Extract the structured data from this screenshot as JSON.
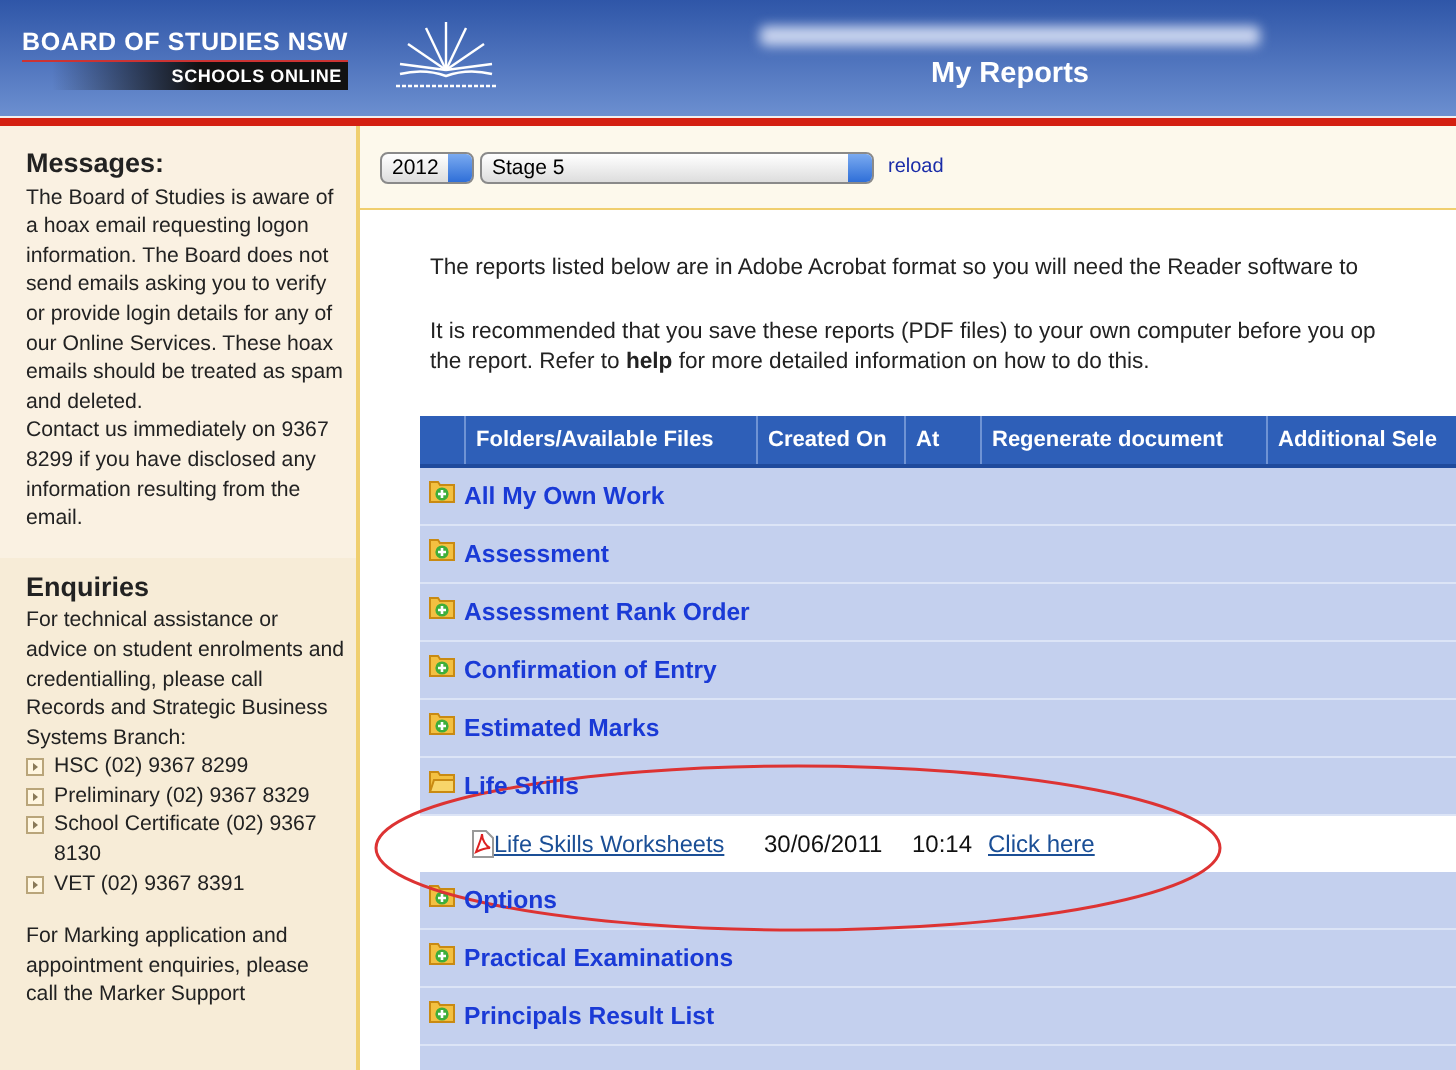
{
  "header": {
    "logo_line1": "BOARD OF STUDIES NSW",
    "logo_line2": "SCHOOLS ONLINE",
    "title": "My Reports"
  },
  "sidebar": {
    "messages": {
      "title": "Messages:",
      "paragraphs": [
        "The Board of Studies is aware of a hoax email requesting logon information. The Board does not send emails asking you to verify or provide login details for any of our Online Services. These hoax emails should be treated as spam and deleted.",
        "Contact us immediately on 9367 8299 if you have disclosed any information resulting from the email."
      ]
    },
    "enquiries": {
      "title": "Enquiries",
      "intro": "For technical assistance or advice on student enrolments and credentialling, please call Records and Strategic Business Systems Branch:",
      "contacts": [
        "HSC (02) 9367 8299",
        "Preliminary (02) 9367 8329",
        "School Certificate (02) 9367 8130",
        "VET (02) 9367 8391"
      ],
      "note": "For Marking application and appointment enquiries, please call the Marker Support"
    }
  },
  "toolbar": {
    "year": "2012",
    "stage": "Stage 5",
    "reload": "reload"
  },
  "intro": [
    [
      "The reports listed below are in Adobe Acrobat format so you will need the Reader software to"
    ],
    [
      "It is recommended that you save these reports (PDF files) to your own computer before you op",
      "the report. Refer to **help** for more detailed information on how to do this."
    ]
  ],
  "table": {
    "columns": [
      "Folders/Available Files",
      "Created On",
      "At",
      "Regenerate document",
      "Additional Sele"
    ],
    "rows": [
      {
        "name": "All My Own Work",
        "expanded": false
      },
      {
        "name": "Assessment",
        "expanded": false
      },
      {
        "name": "Assessment Rank Order",
        "expanded": false
      },
      {
        "name": "Confirmation of Entry",
        "expanded": false
      },
      {
        "name": "Estimated Marks",
        "expanded": false
      },
      {
        "name": "Life Skills",
        "expanded": true,
        "children": [
          {
            "name": "Life Skills Worksheets",
            "created_on": "30/06/2011",
            "at": "10:14",
            "regenerate": "Click here"
          }
        ]
      },
      {
        "name": "Options",
        "expanded": false
      },
      {
        "name": "Practical Examinations",
        "expanded": false
      },
      {
        "name": "Principals Result List",
        "expanded": false
      }
    ]
  }
}
